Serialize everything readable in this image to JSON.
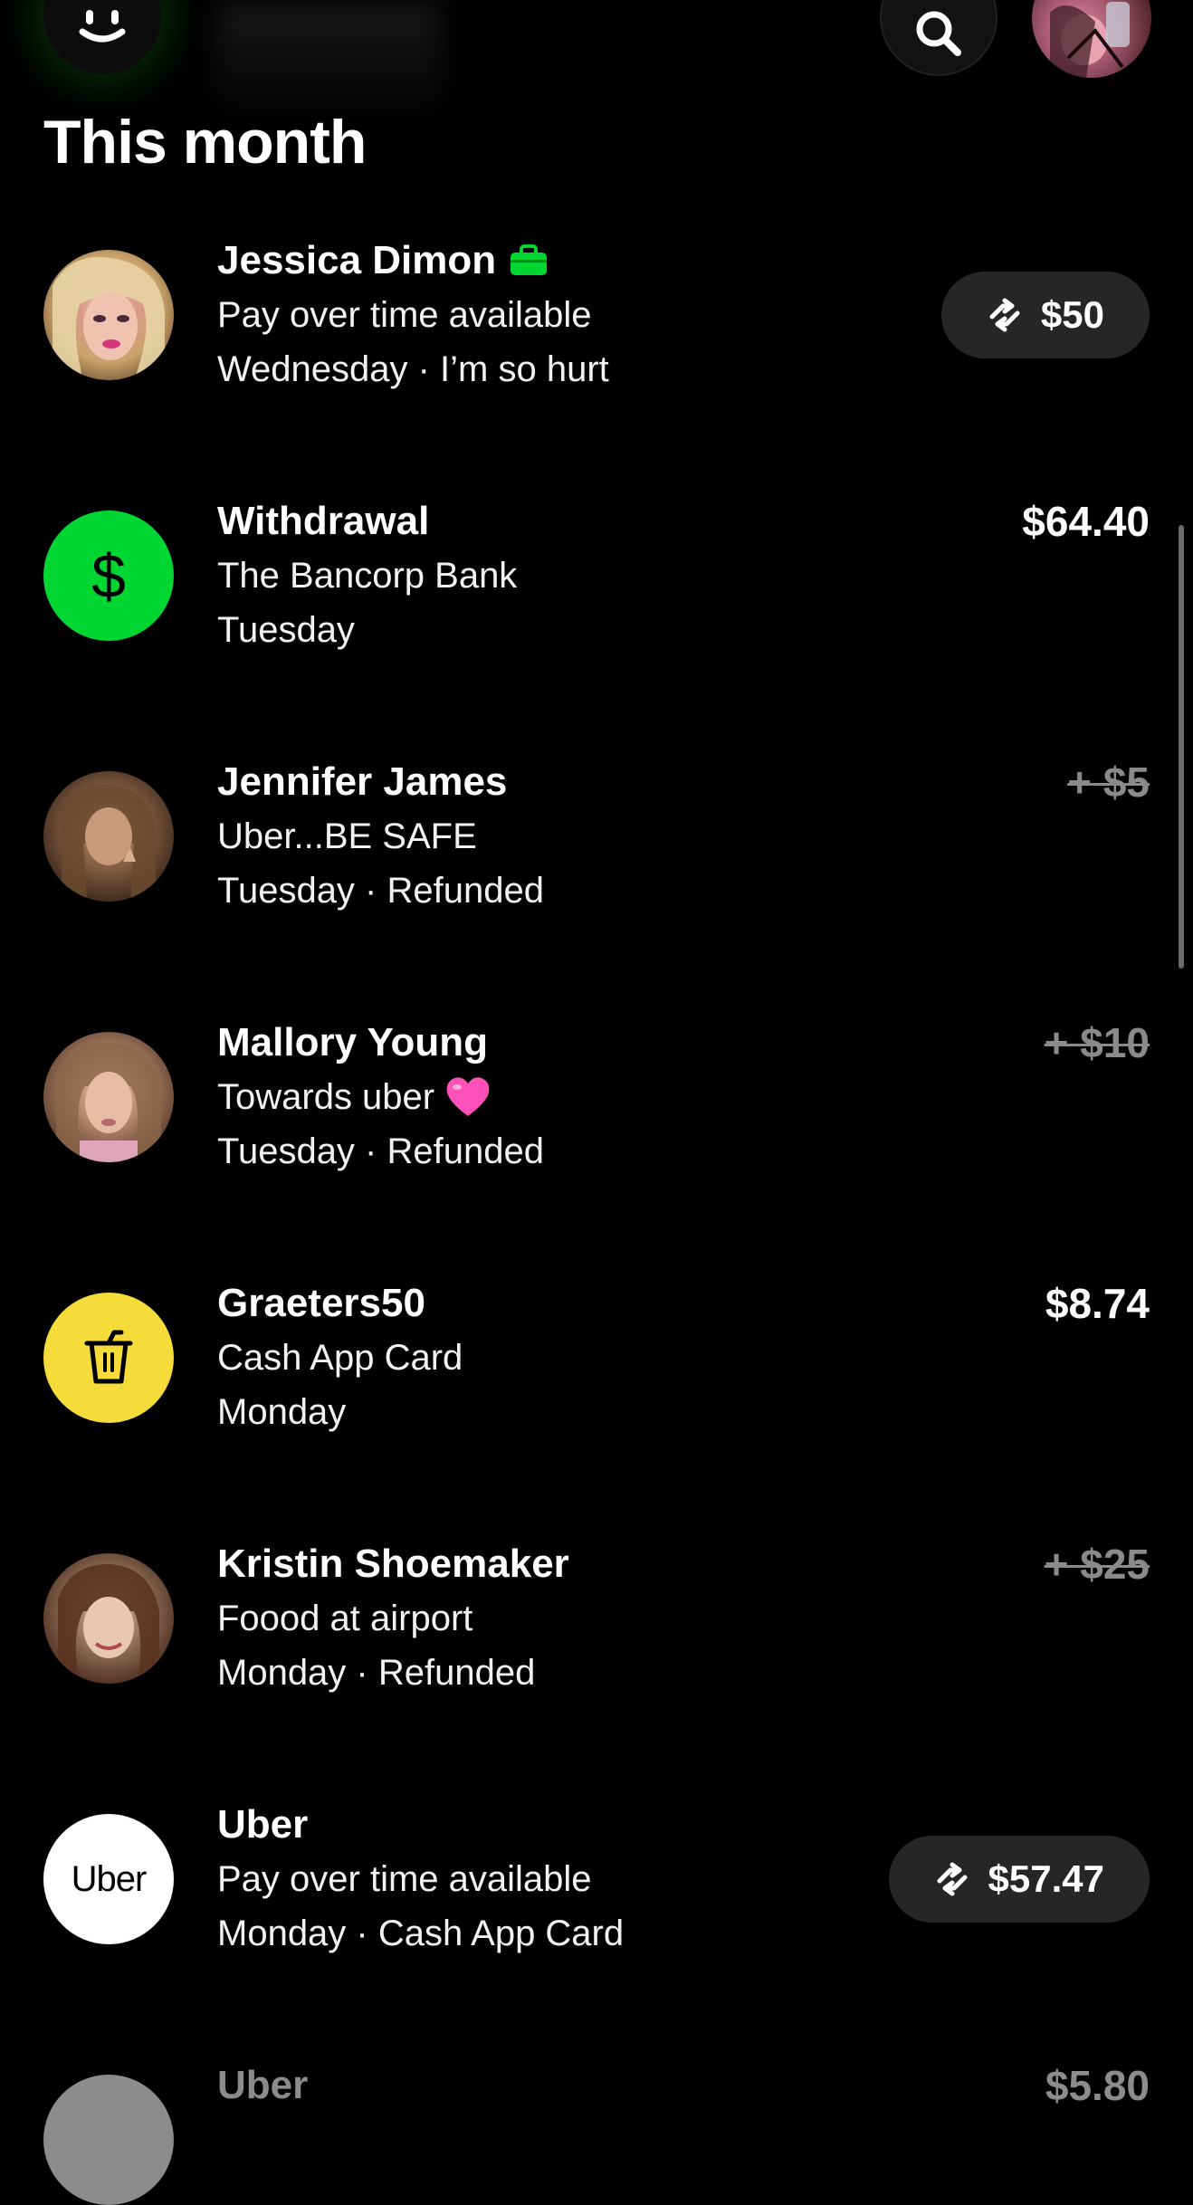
{
  "header": {
    "section_title": "This month"
  },
  "transactions": [
    {
      "name": "Jessica Dimon",
      "line1": "Pay over time available",
      "line2": "Wednesday · I’m so hurt",
      "amount": "$50",
      "amount_style": "pill",
      "avatar": "photo",
      "badge": "briefcase-icon"
    },
    {
      "name": "Withdrawal",
      "line1": "The Bancorp Bank",
      "line2": "Tuesday",
      "amount": "$64.40",
      "amount_style": "plain",
      "avatar": "dollar-icon",
      "avatar_color": "#00d632"
    },
    {
      "name": "Jennifer James",
      "line1": "Uber...BE SAFE",
      "line2": "Tuesday · Refunded",
      "amount": "+ $5",
      "amount_style": "refunded",
      "avatar": "photo"
    },
    {
      "name": "Mallory Young",
      "line1": "Towards uber",
      "line2": "Tuesday · Refunded",
      "amount": "+ $10",
      "amount_style": "refunded",
      "avatar": "photo",
      "emoji": "pink-heart-icon"
    },
    {
      "name": "Graeters50",
      "line1": "Cash App Card",
      "line2": "Monday",
      "amount": "$8.74",
      "amount_style": "plain",
      "avatar": "cup-icon",
      "avatar_color": "#f5dc3b"
    },
    {
      "name": "Kristin Shoemaker",
      "line1": "Foood at airport",
      "line2": "Monday · Refunded",
      "amount": "+ $25",
      "amount_style": "refunded",
      "avatar": "photo"
    },
    {
      "name": "Uber",
      "line1": "Pay over time available",
      "line2": "Monday · Cash App Card",
      "amount": "$57.47",
      "amount_style": "pill",
      "avatar": "uber-logo",
      "avatar_text": "Uber"
    },
    {
      "name": "Uber",
      "amount": "$5.80",
      "amount_style": "plain",
      "avatar": "uber-logo"
    }
  ],
  "colors": {
    "background": "#000000",
    "accent_green": "#00d632",
    "refunded_gray": "#8a8a8a",
    "pill_bg": "#262626",
    "heart_pink": "#ff4fb8"
  }
}
